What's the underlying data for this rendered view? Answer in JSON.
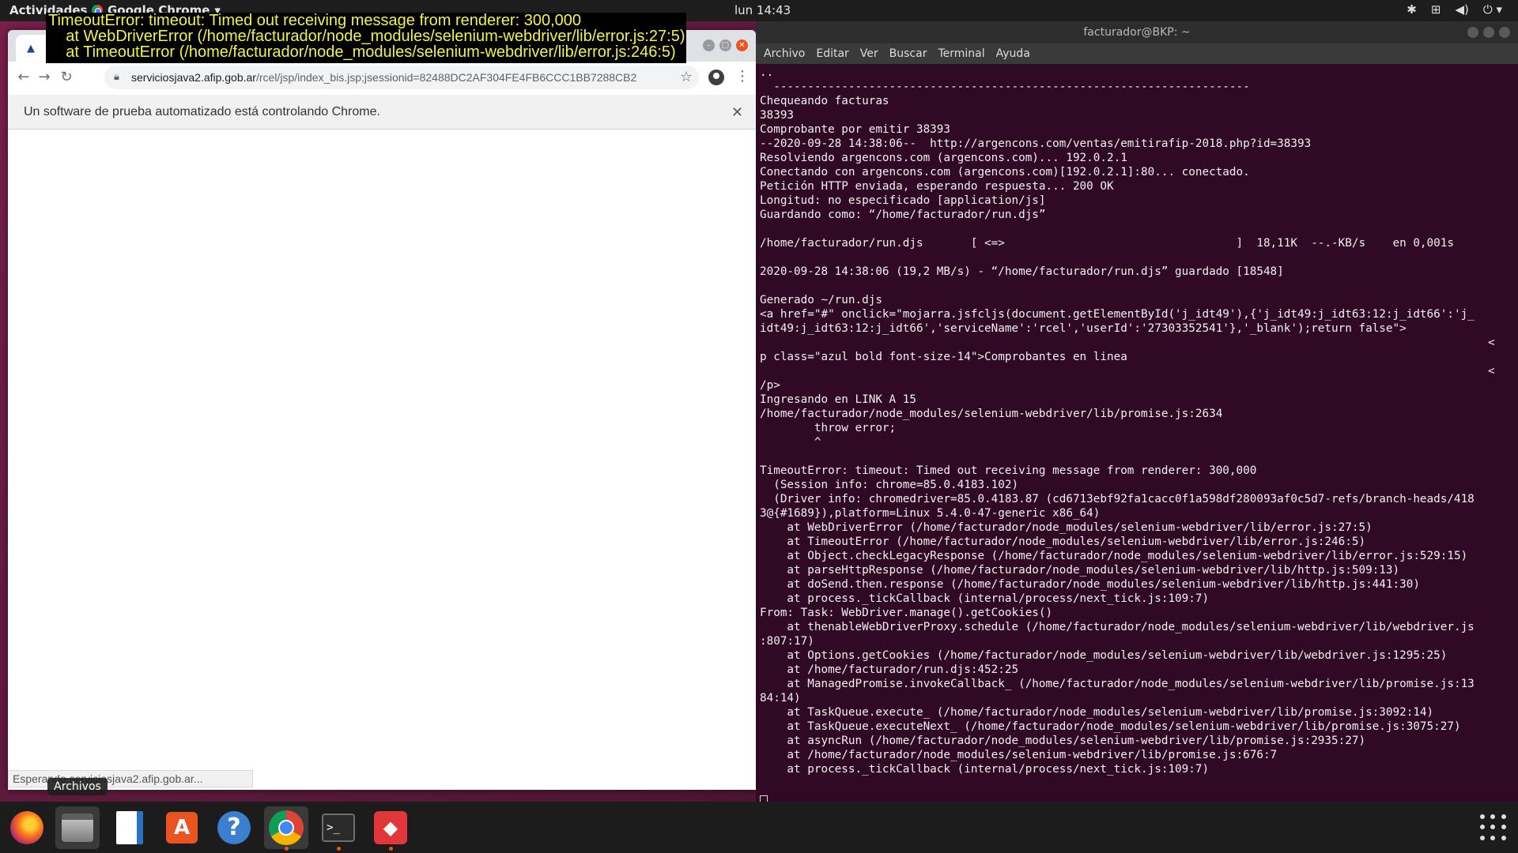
{
  "topbar": {
    "activities": "Actividades",
    "app_menu": "Google Chrome",
    "app_menu_arrow": "▾",
    "clock": "lun 14:43",
    "tray_icons": [
      "bluetooth-icon",
      "network-icon",
      "volume-icon",
      "power-icon"
    ]
  },
  "error_overlay": {
    "lines": [
      "TimeoutError: timeout: Timed out receiving message from renderer: 300,000",
      "    at WebDriverError (/home/facturador/node_modules/selenium-webdriver/lib/error.js:27:5)",
      "    at TimeoutError (/home/facturador/node_modules/selenium-webdriver/lib/error.js:246:5)"
    ],
    "color": "#f2f24a"
  },
  "chrome": {
    "url_host": "serviciosjava2.afip.gob.ar",
    "url_path": "/rcel/jsp/index_bis.jsp;jsessionid=82488DC2AF304FE4FB6CCC1BB7288CB2",
    "infobar_text": "Un software de prueba automatizado está controlando Chrome.",
    "status_text": "Esperando serviciosjava2.afip.gob.ar..."
  },
  "tooltip": {
    "label": "Archivos"
  },
  "terminal": {
    "title": "facturador@BKP: ~",
    "menu": [
      "Archivo",
      "Editar",
      "Ver",
      "Buscar",
      "Terminal",
      "Ayuda"
    ],
    "lines": [
      "..",
      "  ----------------------------------------------------------------------",
      "Chequeando facturas",
      "38393",
      "Comprobante por emitir 38393",
      "--2020-09-28 14:38:06--  http://argencons.com/ventas/emitirafip-2018.php?id=38393",
      "Resolviendo argencons.com (argencons.com)... 192.0.2.1",
      "Conectando con argencons.com (argencons.com)[192.0.2.1]:80... conectado.",
      "Petición HTTP enviada, esperando respuesta... 200 OK",
      "Longitud: no especificado [application/js]",
      "Guardando como: “/home/facturador/run.djs”",
      "",
      "/home/facturador/run.djs       [ <=>                                  ]  18,11K  --.-KB/s    en 0,001s",
      "",
      "2020-09-28 14:38:06 (19,2 MB/s) - “/home/facturador/run.djs” guardado [18548]",
      "",
      "Generado ~/run.djs",
      "<a href=\"#\" onclick=\"mojarra.jsfcljs(document.getElementById('j_idt49'),{'j_idt49:j_idt63:12:j_idt66':'j_",
      "idt49:j_idt63:12:j_idt66','serviceName':'rcel','userId':'27303352541'},'_blank');return false\">",
      "                                                                                                           <",
      "p class=\"azul bold font-size-14\">Comprobantes en linea",
      "                                                                                                           <",
      "/p>",
      "Ingresando en LINK A 15",
      "/home/facturador/node_modules/selenium-webdriver/lib/promise.js:2634",
      "        throw error;",
      "        ^",
      "",
      "TimeoutError: timeout: Timed out receiving message from renderer: 300,000",
      "  (Session info: chrome=85.0.4183.102)",
      "  (Driver info: chromedriver=85.0.4183.87 (cd6713ebf92fa1cacc0f1a598df280093af0c5d7-refs/branch-heads/418",
      "3@{#1689}),platform=Linux 5.4.0-47-generic x86_64)",
      "    at WebDriverError (/home/facturador/node_modules/selenium-webdriver/lib/error.js:27:5)",
      "    at TimeoutError (/home/facturador/node_modules/selenium-webdriver/lib/error.js:246:5)",
      "    at Object.checkLegacyResponse (/home/facturador/node_modules/selenium-webdriver/lib/error.js:529:15)",
      "    at parseHttpResponse (/home/facturador/node_modules/selenium-webdriver/lib/http.js:509:13)",
      "    at doSend.then.response (/home/facturador/node_modules/selenium-webdriver/lib/http.js:441:30)",
      "    at process._tickCallback (internal/process/next_tick.js:109:7)",
      "From: Task: WebDriver.manage().getCookies()",
      "    at thenableWebDriverProxy.schedule (/home/facturador/node_modules/selenium-webdriver/lib/webdriver.js",
      ":807:17)",
      "    at Options.getCookies (/home/facturador/node_modules/selenium-webdriver/lib/webdriver.js:1295:25)",
      "    at /home/facturador/run.djs:452:25",
      "    at ManagedPromise.invokeCallback_ (/home/facturador/node_modules/selenium-webdriver/lib/promise.js:13",
      "84:14)",
      "    at TaskQueue.execute_ (/home/facturador/node_modules/selenium-webdriver/lib/promise.js:3092:14)",
      "    at TaskQueue.executeNext_ (/home/facturador/node_modules/selenium-webdriver/lib/promise.js:3075:27)",
      "    at asyncRun (/home/facturador/node_modules/selenium-webdriver/lib/promise.js:2935:27)",
      "    at /home/facturador/node_modules/selenium-webdriver/lib/promise.js:676:7",
      "    at process._tickCallback (internal/process/next_tick.js:109:7)"
    ]
  },
  "dock": {
    "apps": [
      "firefox-icon",
      "files-icon",
      "libreoffice-writer-icon",
      "software-center-icon",
      "help-icon",
      "chrome-icon",
      "terminal-icon",
      "remote-desktop-icon"
    ]
  }
}
